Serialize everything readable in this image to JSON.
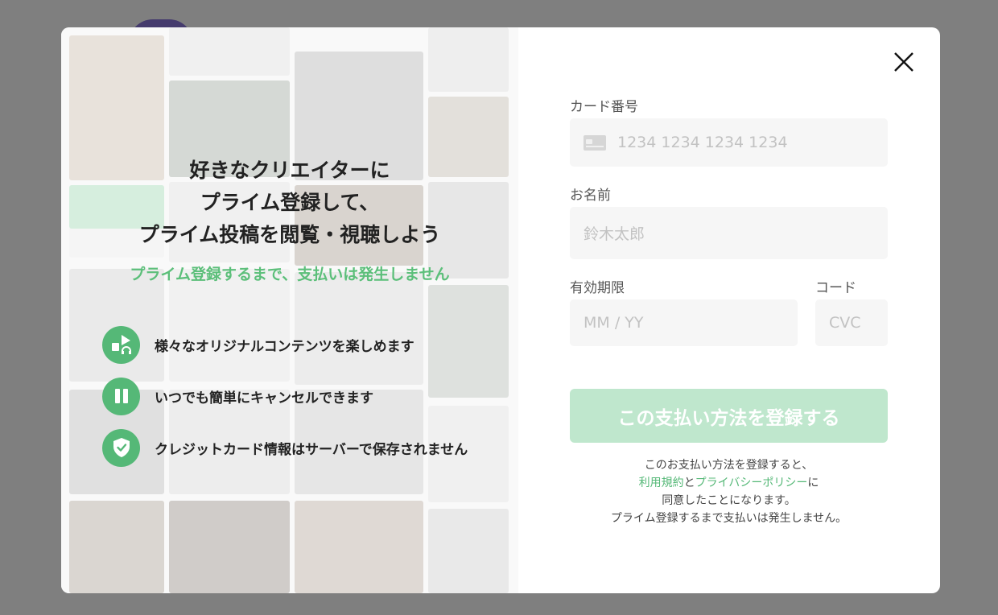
{
  "left_panel": {
    "headline_lines": [
      "好きなクリエイターに",
      "プライム登録して、",
      "プライム投稿を閲覧・視聴しよう"
    ],
    "subline": "プライム登録するまで、支払いは発生しません",
    "features": [
      {
        "icon": "media-icon",
        "text": "様々なオリジナルコンテンツを楽しめます"
      },
      {
        "icon": "pause-icon",
        "text": "いつでも簡単にキャンセルできます"
      },
      {
        "icon": "shield-icon",
        "text": "クレジットカード情報はサーバーで保存されません"
      }
    ]
  },
  "form": {
    "card_number_label": "カード番号",
    "card_number_placeholder": "1234 1234 1234 1234",
    "name_label": "お名前",
    "name_placeholder": "鈴木太郎",
    "expiry_label": "有効期限",
    "expiry_placeholder": "MM / YY",
    "code_label": "コード",
    "code_placeholder": "CVC",
    "submit_label": "この支払い方法を登録する",
    "note_line1": "このお支払い方法を登録すると、",
    "terms_link": "利用規約",
    "and_text": "と",
    "privacy_link": "プライバシーポリシー",
    "ni_text": "に",
    "note_line3": "同意したことになります。",
    "note_line4": "プライム登録するまで支払いは発生しません。"
  },
  "colors": {
    "accent": "#55b877",
    "submit_disabled": "#bfe7cd",
    "overlay": "#7f7f7f"
  }
}
